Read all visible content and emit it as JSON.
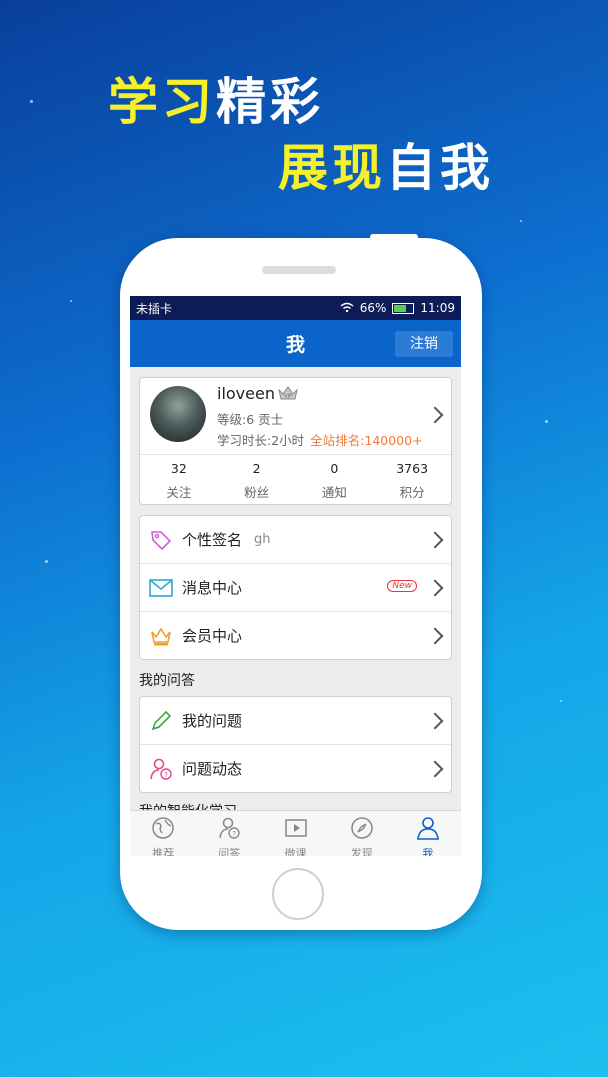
{
  "promo": {
    "line1_yellow": "学习",
    "line1_white": "精彩",
    "line2_yellow": "展现",
    "line2_white": "自我"
  },
  "status_bar": {
    "carrier": "未插卡",
    "battery": "66%",
    "time": "11:09"
  },
  "header": {
    "title": "我",
    "logout_label": "注销"
  },
  "profile": {
    "username": "iloveen",
    "level": "等级:6 贡士",
    "study_time": "学习时长:2小时",
    "rank": "全站排名:140000+",
    "stats": [
      {
        "value": "32",
        "label": "关注"
      },
      {
        "value": "2",
        "label": "粉丝"
      },
      {
        "value": "0",
        "label": "通知"
      },
      {
        "value": "3763",
        "label": "积分"
      }
    ]
  },
  "menu": [
    {
      "label": "个性签名",
      "extra": "gh",
      "icon": "tag-icon"
    },
    {
      "label": "消息中心",
      "badge": "New",
      "icon": "mail-icon"
    },
    {
      "label": "会员中心",
      "icon": "crown-icon"
    }
  ],
  "qa_section": {
    "title": "我的问答",
    "items": [
      {
        "label": "我的问题",
        "icon": "pencil-icon"
      },
      {
        "label": "问题动态",
        "icon": "user-question-icon"
      }
    ]
  },
  "smart_section_title": "我的智能化学习",
  "tabs": [
    {
      "label": "推荐",
      "icon": "globe-icon"
    },
    {
      "label": "问答",
      "icon": "qa-icon"
    },
    {
      "label": "微课",
      "icon": "video-icon"
    },
    {
      "label": "发现",
      "icon": "compass-icon"
    },
    {
      "label": "我",
      "icon": "person-icon",
      "active": true
    }
  ],
  "colors": {
    "accent": "#0a64c9",
    "headline_yellow": "#f6f02b",
    "rank_orange": "#f07a3a"
  }
}
